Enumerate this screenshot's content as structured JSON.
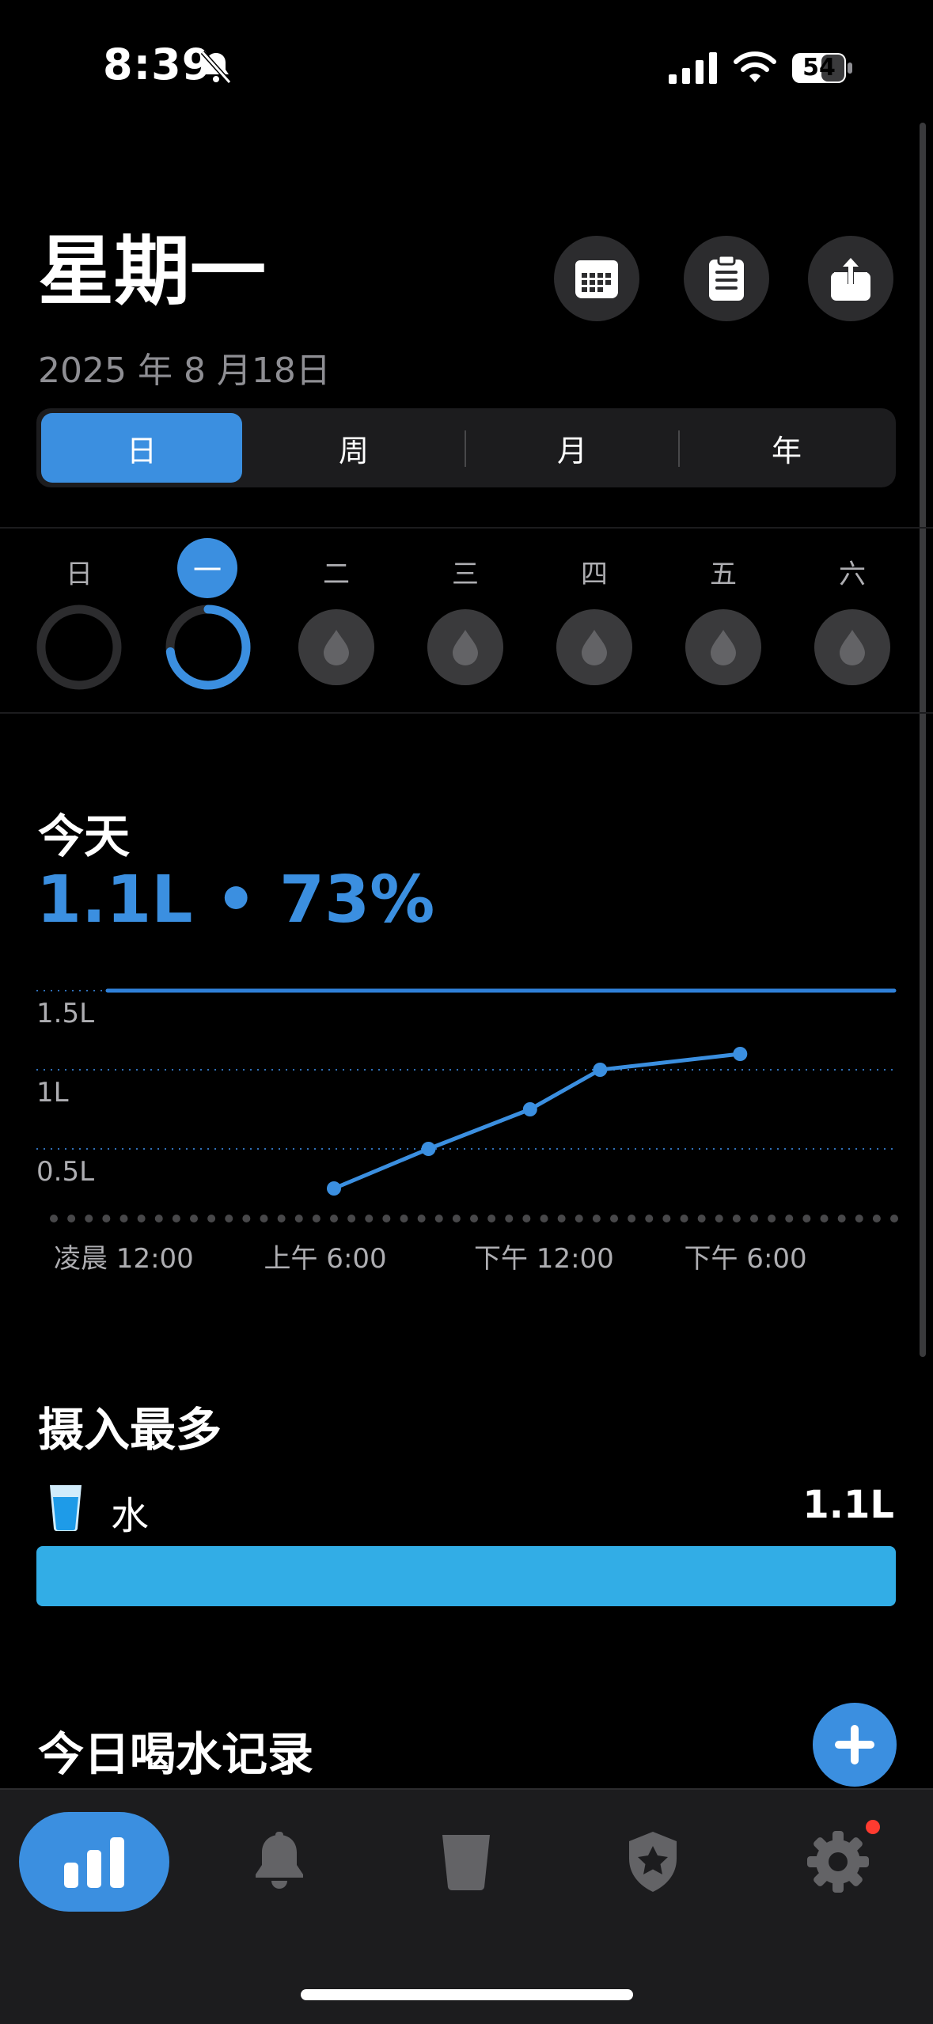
{
  "status_bar": {
    "time": "8:39",
    "battery": "54",
    "icons": [
      "bell-slash-icon",
      "cellular-signal-icon",
      "wifi-icon",
      "battery-icon"
    ]
  },
  "header": {
    "day_title": "星期一",
    "date": "2025 年 8 月18日",
    "buttons": [
      "calendar-icon",
      "clipboard-icon",
      "share-icon"
    ]
  },
  "segments": {
    "items": [
      "日",
      "周",
      "月",
      "年"
    ],
    "selected": "日"
  },
  "week": {
    "days": [
      "日",
      "一",
      "二",
      "三",
      "四",
      "五",
      "六"
    ],
    "selected_index": 1,
    "progress": [
      0,
      0.73,
      null,
      null,
      null,
      null,
      null
    ]
  },
  "today": {
    "label": "今天",
    "value": "1.1L • 73%"
  },
  "chart_data": {
    "type": "line",
    "title": "",
    "xlabel": "",
    "ylabel": "",
    "x_ticks": [
      "凌晨 12:00",
      "上午 6:00",
      "下午 12:00",
      "下午 6:00"
    ],
    "y_ticks": [
      "1.5L",
      "1L",
      "0.5L"
    ],
    "ylim_liters": [
      0,
      1.5
    ],
    "goal_liters": 1.5,
    "series": [
      {
        "x_hours": [
          8.0,
          10.7,
          13.6,
          15.6,
          19.6
        ],
        "y_liters": [
          0.25,
          0.5,
          0.75,
          1.0,
          1.1
        ]
      }
    ],
    "colors": {
      "line": "#3b8fe0",
      "goal": "#2f80d8",
      "grid": "#2f6fb8",
      "dots": "#48484a"
    }
  },
  "most_intake": {
    "title": "摄入最多",
    "items": [
      {
        "icon": "water-cup-icon",
        "name": "水",
        "amount": "1.1L",
        "share": 1.0
      }
    ]
  },
  "log": {
    "title": "今日喝水记录",
    "add_icon": "plus-icon"
  },
  "tab_bar": {
    "tabs": [
      "bar-chart-icon",
      "bell-icon",
      "cup-icon",
      "shield-star-icon",
      "gear-icon"
    ],
    "selected_index": 0
  },
  "colors": {
    "accent": "#3b8fe0",
    "water": "#32ade6",
    "background": "#000000",
    "surface": "#1c1c1e",
    "notification": "#ff3b30"
  }
}
